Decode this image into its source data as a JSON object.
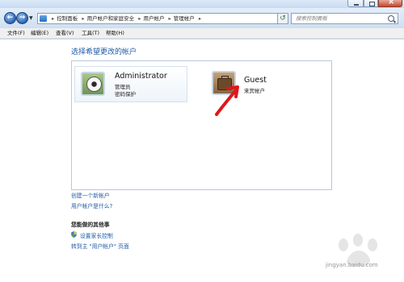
{
  "navigation": {
    "breadcrumbs": [
      "控制面板",
      "用户帐户和家庭安全",
      "用户帐户",
      "管理帐户"
    ],
    "search_placeholder": "搜索控制面板"
  },
  "menu": [
    "文件(F)",
    "编辑(E)",
    "查看(V)",
    "工具(T)",
    "帮助(H)"
  ],
  "main": {
    "heading": "选择希望更改的帐户",
    "accounts": [
      {
        "name": "Administrator",
        "type": "管理员",
        "status": "密码保护",
        "icon": "soccer-ball-icon"
      },
      {
        "name": "Guest",
        "type": "来宾帐户",
        "icon": "briefcase-icon"
      }
    ],
    "links": [
      "创建一个新帐户",
      "用户帐户是什么?"
    ],
    "other_section_title": "您能做的其他事",
    "other_links": [
      "设置家长控制",
      "转到主 \"用户帐户\" 页面"
    ]
  },
  "watermark": {
    "text": "jingyan.baidu.com"
  },
  "colors": {
    "link": "#1e5ba5",
    "annotation_arrow": "#e0161b"
  }
}
